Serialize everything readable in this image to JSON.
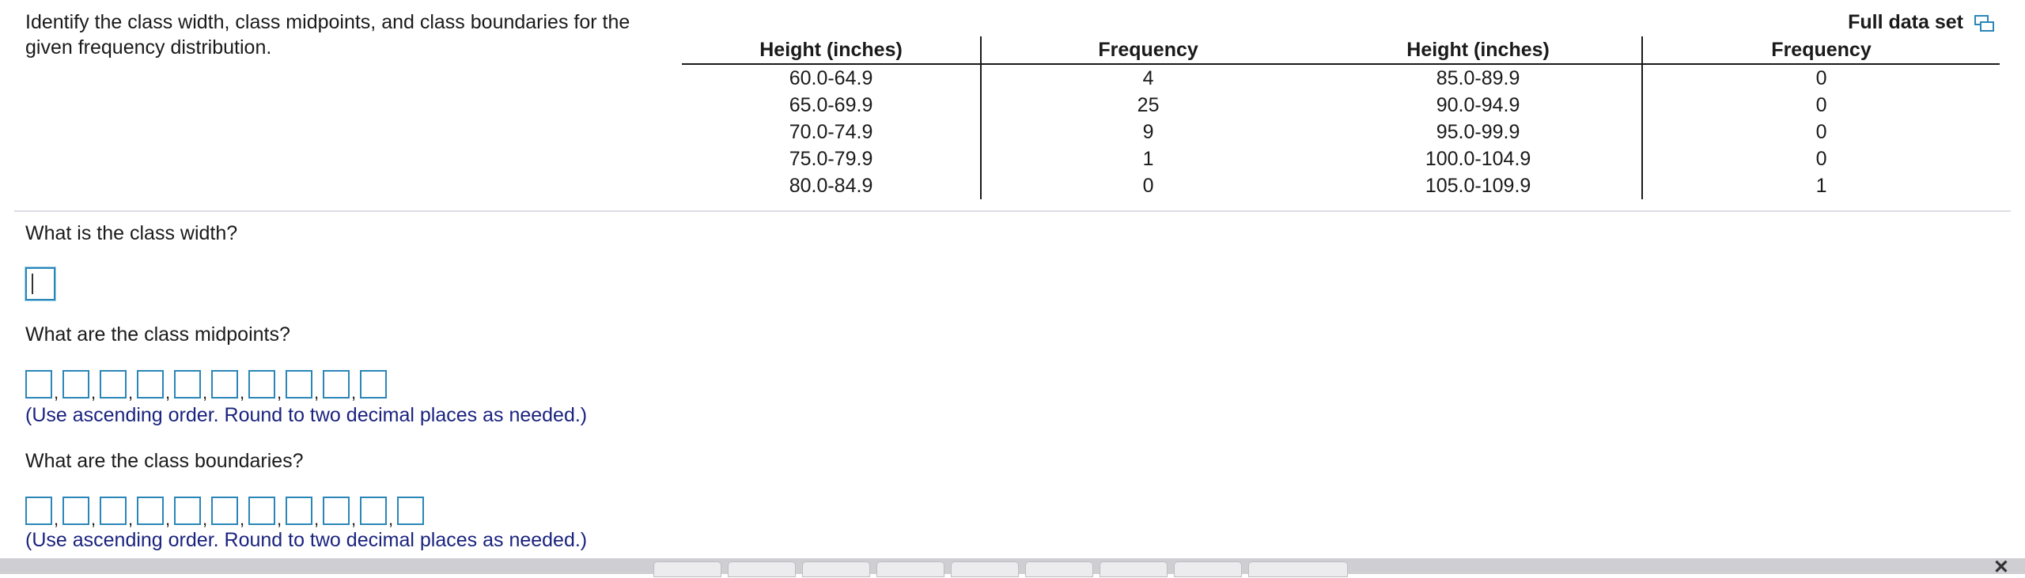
{
  "prompt": "Identify the class width, class midpoints, and class boundaries for the given frequency distribution.",
  "full_data_label": "Full data set",
  "table": {
    "headers": [
      "Height (inches)",
      "Frequency",
      "Height (inches)",
      "Frequency"
    ],
    "rows": [
      [
        "60.0-64.9",
        "4",
        "85.0-89.9",
        "0"
      ],
      [
        "65.0-69.9",
        "25",
        "90.0-94.9",
        "0"
      ],
      [
        "70.0-74.9",
        "9",
        "95.0-99.9",
        "0"
      ],
      [
        "75.0-79.9",
        "1",
        "100.0-104.9",
        "0"
      ],
      [
        "80.0-84.9",
        "0",
        "105.0-109.9",
        "1"
      ]
    ]
  },
  "q1": {
    "text": "What is the class width?",
    "value": ""
  },
  "q2": {
    "text": "What are the class midpoints?",
    "hint": "(Use ascending order. Round to two decimal places as needed.)",
    "box_count": 10
  },
  "q3": {
    "text": "What are the class boundaries?",
    "hint": "(Use ascending order. Round to two decimal places as needed.)",
    "box_count": 11
  },
  "icons": {
    "full_data": "copy-icon",
    "close": "close-icon"
  },
  "colors": {
    "accent": "#2a86b8",
    "hint": "#1a237e"
  }
}
